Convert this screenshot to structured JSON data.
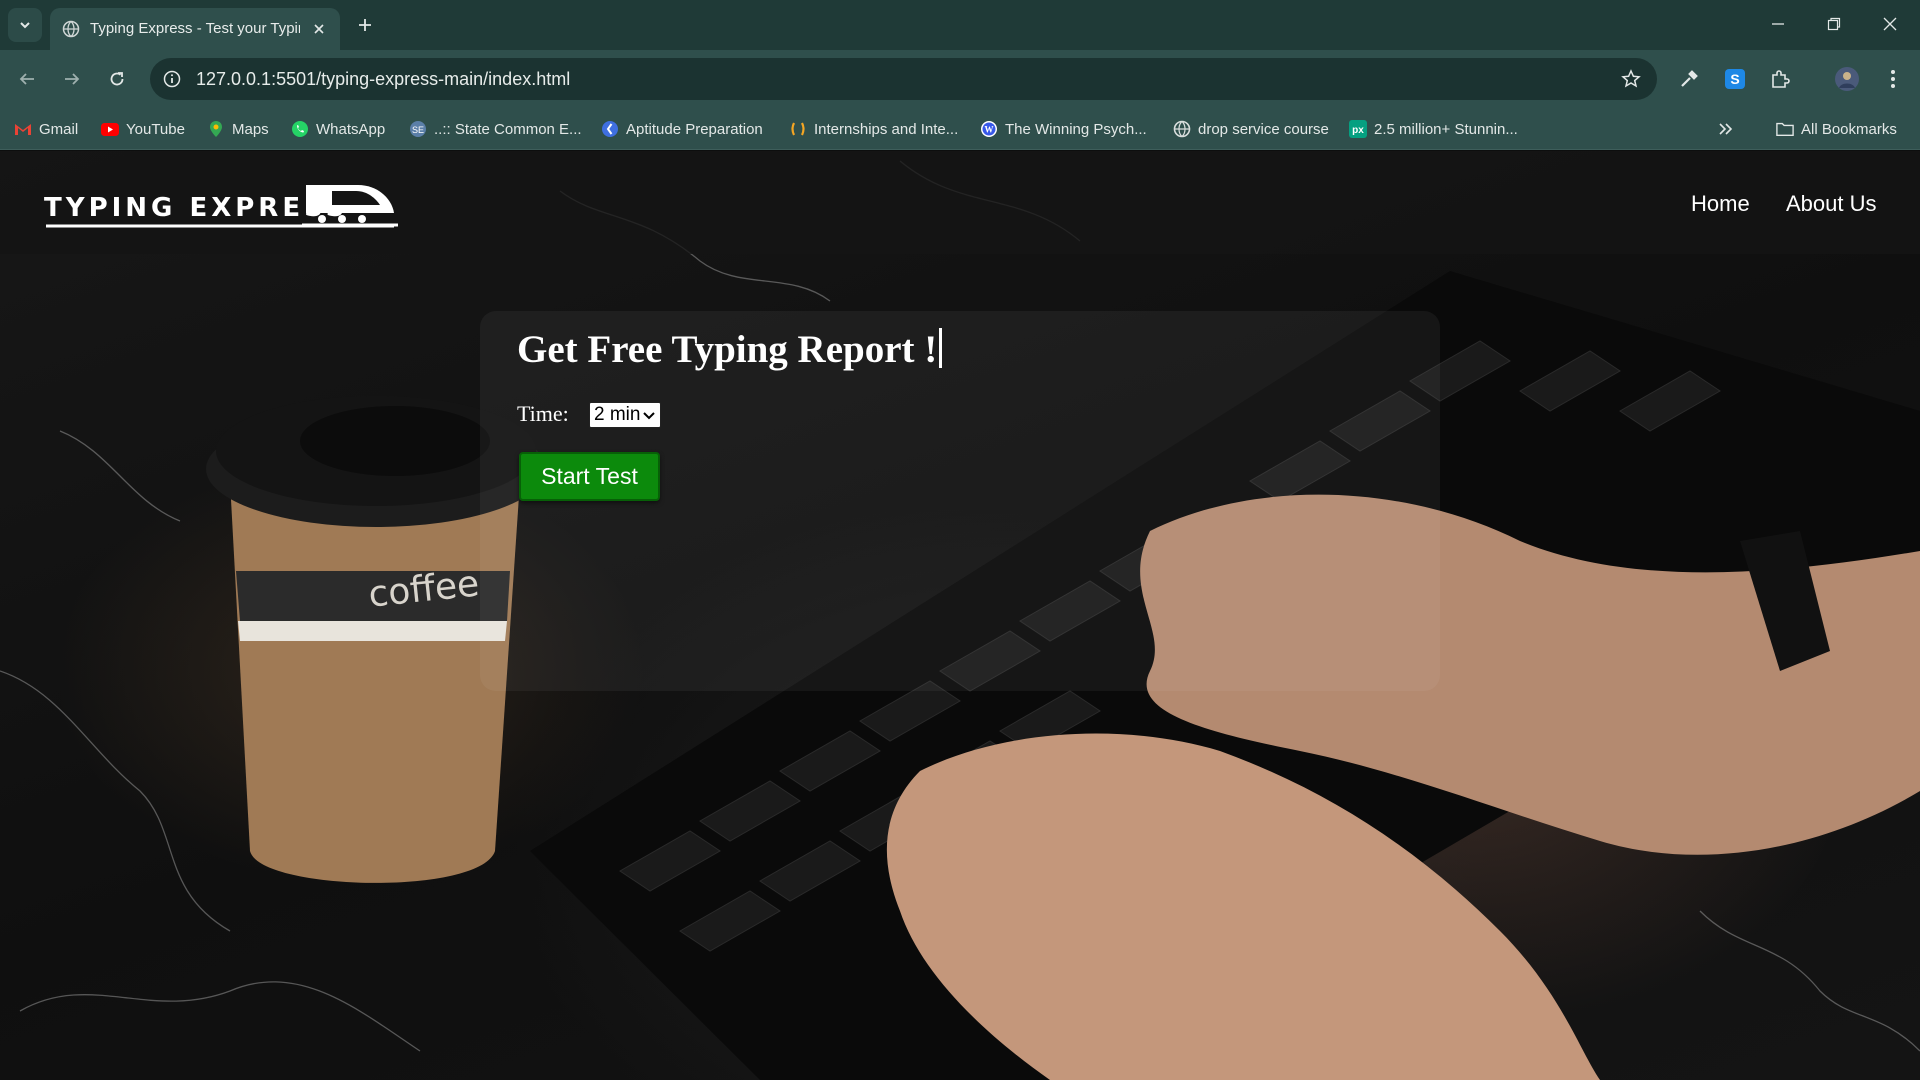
{
  "browser": {
    "tab_title": "Typing Express - Test your Typir",
    "url": "127.0.0.1:5501/typing-express-main/index.html",
    "bookmarks": [
      {
        "label": "Gmail",
        "icon": "gmail-icon"
      },
      {
        "label": "YouTube",
        "icon": "youtube-icon"
      },
      {
        "label": "Maps",
        "icon": "maps-icon"
      },
      {
        "label": "WhatsApp",
        "icon": "whatsapp-icon"
      },
      {
        "label": "..:: State Common E...",
        "icon": "globe-icon"
      },
      {
        "label": "Aptitude Preparation",
        "icon": "aptitude-icon"
      },
      {
        "label": "Internships and Inte...",
        "icon": "internshala-icon"
      },
      {
        "label": "The Winning Psych...",
        "icon": "wordpress-icon"
      },
      {
        "label": "drop service course",
        "icon": "globe-icon"
      },
      {
        "label": "2.5 million+ Stunnin...",
        "icon": "pexels-icon"
      }
    ],
    "all_bookmarks": "All Bookmarks"
  },
  "site": {
    "logo_text": "TYPING EXPRESS",
    "nav": {
      "home": "Home",
      "about": "About Us"
    },
    "heading": "Get Free Typing Report !",
    "time_label": "Time:",
    "time_value": "2 min",
    "start_button": "Start Test",
    "coffee_cup_text": "coffee"
  },
  "colors": {
    "chrome": "#1f3a37",
    "toolbar": "#2f4f4c",
    "start_button": "#0c8a0c"
  }
}
